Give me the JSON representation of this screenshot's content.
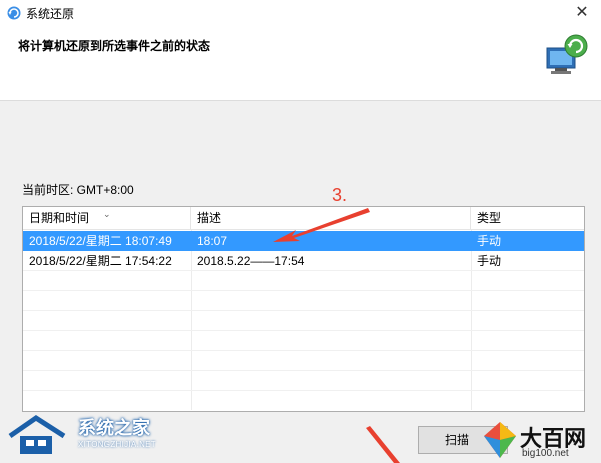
{
  "window": {
    "title": "系统还原",
    "close_glyph": "✕",
    "icon": "system-restore-icon"
  },
  "header": {
    "heading": "将计算机还原到所选事件之前的状态",
    "icon": "computer-restore-icon"
  },
  "timezone_label": "当前时区: GMT+8:00",
  "table": {
    "columns": [
      "日期和时间",
      "描述",
      "类型"
    ],
    "sort_indicator": "⌄",
    "rows": [
      {
        "date": "2018/5/22/星期二 18:07:49",
        "desc": "18:07",
        "type": "手动",
        "selected": true
      },
      {
        "date": "2018/5/22/星期二 17:54:22",
        "desc": "2018.5.22——17:54",
        "type": "手动",
        "selected": false
      }
    ]
  },
  "annotation": {
    "label": "3.",
    "color": "#e8402f"
  },
  "buttons": {
    "scan": "扫描"
  },
  "watermarks": {
    "left_title": "系统之家",
    "left_sub": "XITONGZHIJIA.NET",
    "right_title": "大百网",
    "right_sub": "big100.net"
  },
  "colors": {
    "selection": "#3399ff",
    "window_bg": "#f0f0f0"
  }
}
